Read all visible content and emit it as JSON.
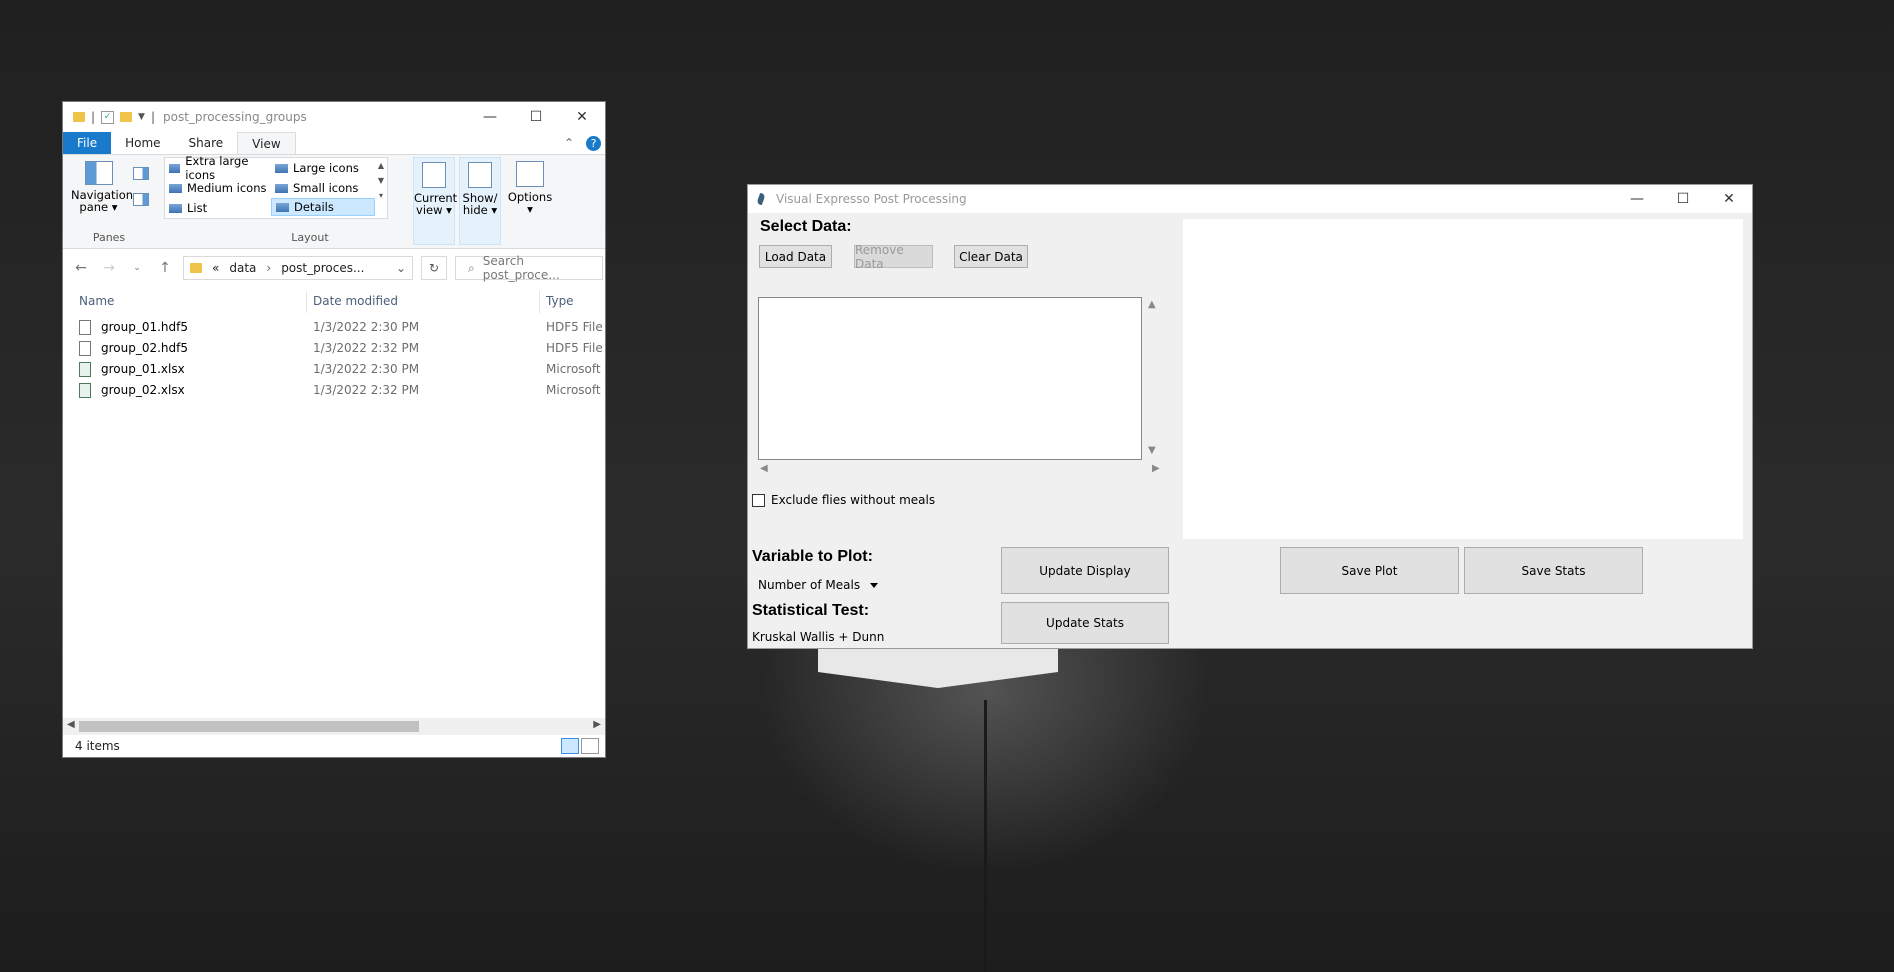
{
  "explorer": {
    "title": "post_processing_groups",
    "tabs": [
      "File",
      "Home",
      "Share",
      "View"
    ],
    "active_tab": "View",
    "panes": {
      "navigation_pane_label_1": "Navigation",
      "navigation_pane_label_2": "pane",
      "group_label": "Panes"
    },
    "layout": {
      "items": [
        "Extra large icons",
        "Large icons",
        "Medium icons",
        "Small icons",
        "List",
        "Details"
      ],
      "selected": "Details",
      "group_label": "Layout"
    },
    "current_view": {
      "line1": "Current",
      "line2": "view"
    },
    "show_hide": {
      "line1": "Show/",
      "line2": "hide"
    },
    "options": "Options",
    "address": {
      "chevrons": "«",
      "segments": [
        "data",
        "post_proces..."
      ]
    },
    "search_placeholder": "Search post_proce...",
    "columns": [
      "Name",
      "Date modified",
      "Type"
    ],
    "files": [
      {
        "name": "group_01.hdf5",
        "date": "1/3/2022 2:30 PM",
        "type": "HDF5 File",
        "kind": "hdf5"
      },
      {
        "name": "group_02.hdf5",
        "date": "1/3/2022 2:32 PM",
        "type": "HDF5 File",
        "kind": "hdf5"
      },
      {
        "name": "group_01.xlsx",
        "date": "1/3/2022 2:30 PM",
        "type": "Microsoft E",
        "kind": "xlsx"
      },
      {
        "name": "group_02.xlsx",
        "date": "1/3/2022 2:32 PM",
        "type": "Microsoft E",
        "kind": "xlsx"
      }
    ],
    "status": "4 items"
  },
  "app": {
    "title": "Visual Expresso Post Processing",
    "select_data_label": "Select Data:",
    "load_button": "Load Data",
    "remove_button": "Remove Data",
    "clear_button": "Clear Data",
    "exclude_checkbox": {
      "label": "Exclude flies without meals",
      "checked": false
    },
    "variable_label": "Variable to Plot:",
    "variable_value": "Number of Meals",
    "stat_test_label": "Statistical Test:",
    "stat_test_value": "Kruskal Wallis + Dunn",
    "update_display_button": "Update Display",
    "update_stats_button": "Update Stats",
    "save_plot_button": "Save Plot",
    "save_stats_button": "Save Stats"
  }
}
